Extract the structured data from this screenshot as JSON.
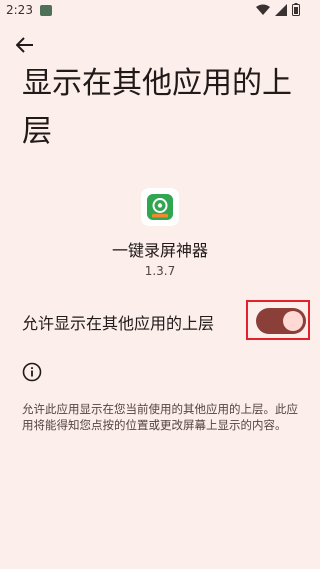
{
  "status_bar": {
    "time": "2:23",
    "icons": [
      "gallery-icon",
      "wifi-icon",
      "signal-icon",
      "battery-icon"
    ]
  },
  "header": {
    "back_icon": "arrow-back-icon"
  },
  "page": {
    "title": "显示在其他应用的上层"
  },
  "app": {
    "name": "一键录屏神器",
    "version": "1.3.7"
  },
  "setting": {
    "label": "允许显示在其他应用的上层",
    "enabled": true
  },
  "info": {
    "icon": "info-icon",
    "description": "允许此应用显示在您当前使用的其他应用的上层。此应用将能得知您点按的位置或更改屏幕上显示的内容。"
  },
  "colors": {
    "background": "#fbeeeb",
    "toggle_track": "#8b3f39",
    "toggle_thumb": "#ffdad5",
    "highlight": "#e3212a",
    "app_icon_green": "#2fa64f"
  }
}
